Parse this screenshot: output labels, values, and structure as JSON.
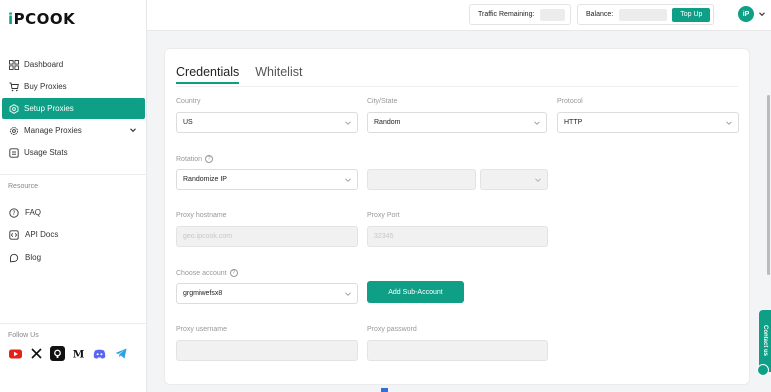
{
  "brand": {
    "logo_pre": "i",
    "logo_post": "PCOOK",
    "accent": "#0e9f86"
  },
  "sidebar": {
    "items": [
      {
        "label": "Dashboard",
        "icon": "grid-icon",
        "active": false
      },
      {
        "label": "Buy Proxies",
        "icon": "cart-icon",
        "active": false
      },
      {
        "label": "Setup Proxies",
        "icon": "setup-icon",
        "active": true
      },
      {
        "label": "Manage Proxies",
        "icon": "gear-icon",
        "active": false
      },
      {
        "label": "Usage Stats",
        "icon": "stats-icon",
        "active": false
      }
    ],
    "resource_label": "Resource",
    "resources": [
      {
        "label": "FAQ",
        "icon": "help-icon"
      },
      {
        "label": "API Docs",
        "icon": "api-icon"
      },
      {
        "label": "Blog",
        "icon": "blog-icon"
      }
    ],
    "follow_label": "Follow Us",
    "socials": [
      "youtube-icon",
      "x-icon",
      "github-icon",
      "medium-icon",
      "discord-icon",
      "telegram-icon"
    ]
  },
  "header": {
    "traffic_label": "Traffic Remaining:",
    "balance_label": "Balance:",
    "topup_label": "Top Up",
    "avatar_text": "iP"
  },
  "tabs": [
    {
      "label": "Credentials",
      "active": true
    },
    {
      "label": "Whitelist",
      "active": false
    }
  ],
  "form": {
    "country_label": "Country",
    "country_value": "US",
    "city_label": "City/State",
    "city_value": "Random",
    "protocol_label": "Protocol",
    "protocol_value": "HTTP",
    "rotation_label": "Rotation",
    "rotation_value": "Randomize IP",
    "hostname_label": "Proxy hostname",
    "hostname_value": "geo.ipcook.com",
    "port_label": "Proxy Port",
    "port_value": "32345",
    "account_label": "Choose account",
    "account_value": "grgmiwefsx8",
    "add_sub_label": "Add Sub-Account",
    "username_label": "Proxy username",
    "password_label": "Proxy password"
  },
  "contact_label": "Contact us"
}
